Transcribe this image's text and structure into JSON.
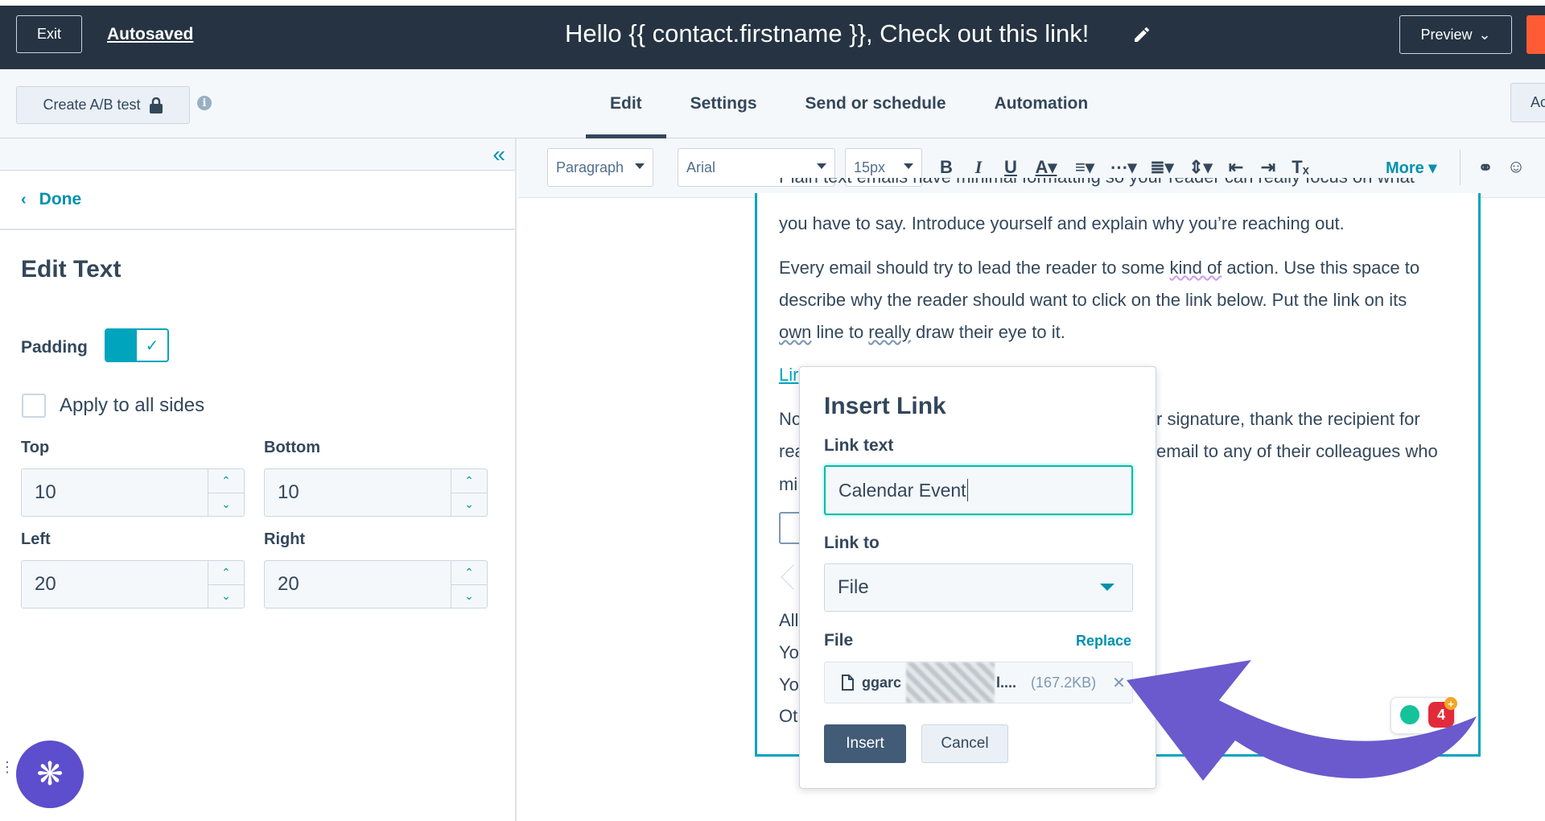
{
  "topbar": {
    "exit_label": "Exit",
    "autosaved_label": "Autosaved",
    "email_title": "Hello {{ contact.firstname }}, Check out this link!",
    "preview_label": "Preview"
  },
  "subbar": {
    "ab_test_label": "Create A/B test",
    "tabs": [
      {
        "label": "Edit",
        "active": true
      },
      {
        "label": "Settings",
        "active": false
      },
      {
        "label": "Send or schedule",
        "active": false
      },
      {
        "label": "Automation",
        "active": false
      }
    ],
    "right_btn_label": "Ac"
  },
  "left_panel": {
    "done_label": "Done",
    "title": "Edit Text",
    "padding_label": "Padding",
    "padding_enabled": true,
    "apply_all_label": "Apply to all sides",
    "apply_all_checked": false,
    "fields": {
      "top_label": "Top",
      "top_value": "10",
      "bottom_label": "Bottom",
      "bottom_value": "10",
      "left_label": "Left",
      "left_value": "20",
      "right_label": "Right",
      "right_value": "20"
    }
  },
  "toolbar": {
    "paragraph": "Paragraph",
    "font": "Arial",
    "size": "15px",
    "more_label": "More"
  },
  "email_body": {
    "line0": "Plain text emails have minimal formatting so your reader can really focus on what",
    "line1": "you have to say. Introduce yourself and explain why you’re reaching out.",
    "p2_a": "Every email should try to lead the reader to some ",
    "p2_b": "kind of",
    "p2_c": " action. Use this space to",
    "p2_line2": "describe why the reader should want to click on the link below. Put the link on its",
    "p2_l3_a": "own",
    "p2_l3_b": " line to ",
    "p2_l3_c": "really",
    "p2_l3_d": " draw their eye to it.",
    "link_fragment": "Lir",
    "p3_left1": "No",
    "p3_right1": "r signature, thank the recipient for",
    "p3_left2": "rea",
    "p3_right2": "email to any of their colleagues who",
    "p3_left3": "mi",
    "sig1": "All",
    "sig2": "Yo",
    "sig3": "Yo",
    "sig4": "Ot"
  },
  "dialog": {
    "title": "Insert Link",
    "link_text_label": "Link text",
    "link_text_value": "Calendar Event",
    "link_to_label": "Link to",
    "link_to_value": "File",
    "file_label": "File",
    "replace_label": "Replace",
    "file_name_visible": "ggarc",
    "file_name_tail": "l....",
    "file_size": "(167.2KB)",
    "insert_label": "Insert",
    "cancel_label": "Cancel"
  },
  "grammarly": {
    "count": "4"
  },
  "colors": {
    "topbar": "#253342",
    "accent_teal": "#00a4bd",
    "primary_button": "#425b76",
    "annotation_arrow": "#6a5acd",
    "fab": "#5c4ecc"
  }
}
